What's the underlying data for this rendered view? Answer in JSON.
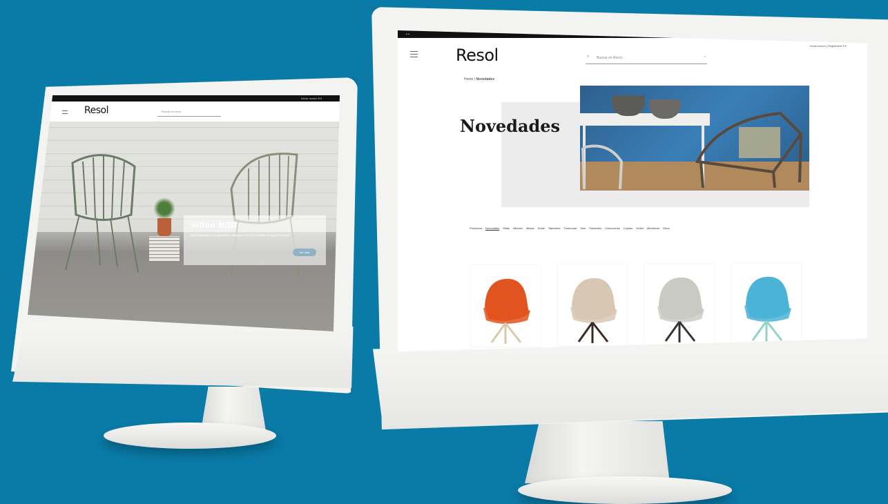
{
  "left_site": {
    "logo": "Resol",
    "search_placeholder": "Buscar en resol...",
    "topbar_right": "Iniciar sesión  EN",
    "hero_title": "Sillón BiBI",
    "hero_text": "Sillón fabricado con polipropileno reforzado con fibra. Modelo ideal para terrazas.",
    "hero_button": "Ver más"
  },
  "right_site": {
    "logo": "Resol",
    "search_placeholder": "Buscar en Resol...",
    "topbar_right": "Iniciar sesión | Registrarse  ES",
    "breadcrumb_home": "Home",
    "breadcrumb_sep": "|",
    "breadcrumb_current": "Novedades",
    "page_title": "Novedades",
    "tabs": [
      "Productos",
      "Novedades",
      "Sillas",
      "Sillones",
      "Mesas",
      "Sofás",
      "Taburetes",
      "Tumbonas",
      "Sets",
      "Parasoles",
      "Colecciones",
      "Cojines",
      "Outlet",
      "Alfombras",
      "Otros"
    ],
    "active_tab": 1,
    "products": [
      {
        "name": "armchair-orange",
        "color": "#e2541f",
        "base": "#d9c9a8"
      },
      {
        "name": "armchair-beige",
        "color": "#d8c8b3",
        "base": "#3a2a22"
      },
      {
        "name": "armchair-grey",
        "color": "#c9cbc3",
        "base": "#333333"
      },
      {
        "name": "armchair-blue",
        "color": "#4ab3d6",
        "base": "#8fd3c7"
      }
    ]
  },
  "colors": {
    "background": "#0a7aa6",
    "bezel": "#f3f3f2"
  }
}
